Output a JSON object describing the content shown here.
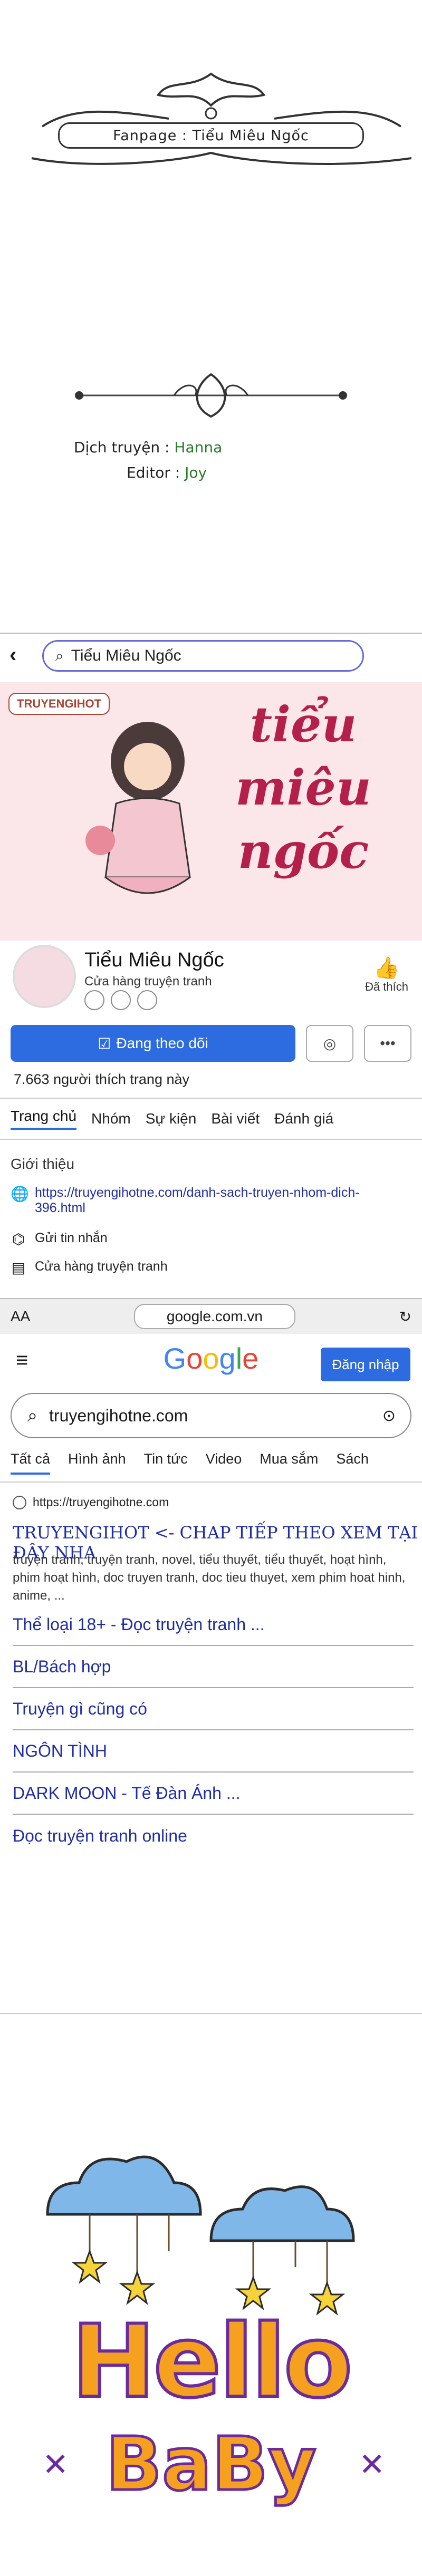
{
  "header": {
    "fanpage_label": "Fanpage : Tiểu Miêu Ngốc",
    "translator_label": "Dịch truyện :",
    "translator_value": "Hanna",
    "editor_label": "Editor :",
    "editor_value": "Joy"
  },
  "facebook": {
    "search_text": "Tiểu Miêu Ngốc",
    "cover_tag": "TRUYENGIHOT",
    "cover_title": "tiểu miêu ngốc",
    "page_name": "Tiểu Miêu Ngốc",
    "page_category": "Cửa hàng truyện tranh",
    "liked_label": "Đã thích",
    "follow_label": "Đang theo dõi",
    "likes_count": "7.663 người thích trang này",
    "tabs": [
      "Trang chủ",
      "Nhóm",
      "Sự kiện",
      "Bài viết",
      "Đánh giá"
    ],
    "intro_label": "Giới thiệu",
    "info": [
      {
        "icon": "globe-icon",
        "text": "https://truyengihotne.com/danh-sach-truyen-nhom-dich-396.html"
      },
      {
        "icon": "messenger-icon",
        "text": "Gửi tin nhắn"
      },
      {
        "icon": "shop-icon",
        "text": "Cửa hàng truyện tranh"
      }
    ],
    "browser_left": "AA",
    "browser_url": "google.com.vn"
  },
  "google": {
    "logo": [
      "G",
      "o",
      "o",
      "g",
      "l",
      "e"
    ],
    "login_label": "Đăng nhập",
    "query": "truyengihotne.com",
    "tabs": [
      "Tất cả",
      "Hình ảnh",
      "Tin tức",
      "Video",
      "Mua sắm",
      "Sách"
    ],
    "result_site": "https://truyengihotne.com",
    "result_title": "TRUYENGIHOT <- CHAP TIẾP THEO XEM TẠI ĐÂY NHA",
    "result_snippet": "truyện tranh, truyện tranh, novel, tiểu thuyết, tiểu thuyết, hoạt hình, phim hoạt hình, doc truyen tranh, doc tieu thuyet, xem phim hoat hinh, anime, ...",
    "sitelinks": [
      "Thể loại 18+ - Đọc truyện tranh ...",
      "BL/Bách hợp",
      "Truyện gì cũng có",
      "NGÔN TÌNH",
      "DARK MOON - Tế Đàn Ánh ...",
      "Đọc truyện tranh online"
    ]
  },
  "hello": {
    "line1": "Hello",
    "line2": "BaBy"
  }
}
